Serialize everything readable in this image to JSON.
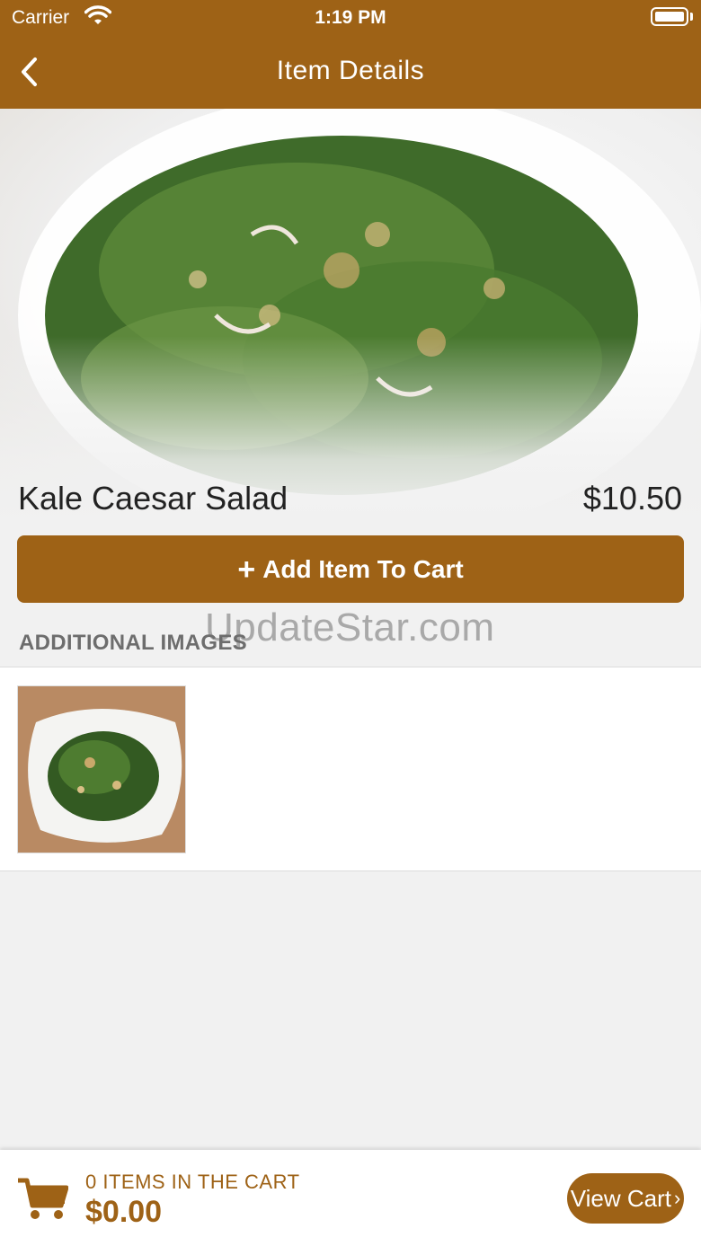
{
  "status_bar": {
    "carrier": "Carrier",
    "time": "1:19 PM"
  },
  "nav": {
    "title": "Item Details"
  },
  "item": {
    "name": "Kale Caesar Salad",
    "price": "$10.50"
  },
  "actions": {
    "add_to_cart_label": "Add Item To Cart"
  },
  "additional_images": {
    "header": "ADDITIONAL IMAGES"
  },
  "watermark": "UpdateStar.com",
  "cart": {
    "count_label": "0 ITEMS IN THE CART",
    "total": "$0.00",
    "view_cart_label": "View Cart"
  },
  "colors": {
    "brand": "#9e6216",
    "background": "#f1f1f1",
    "text": "#222222"
  },
  "icons": [
    "wifi-icon",
    "battery-icon",
    "back-chevron-icon",
    "plus-icon",
    "cart-icon",
    "chevron-right-icon"
  ]
}
